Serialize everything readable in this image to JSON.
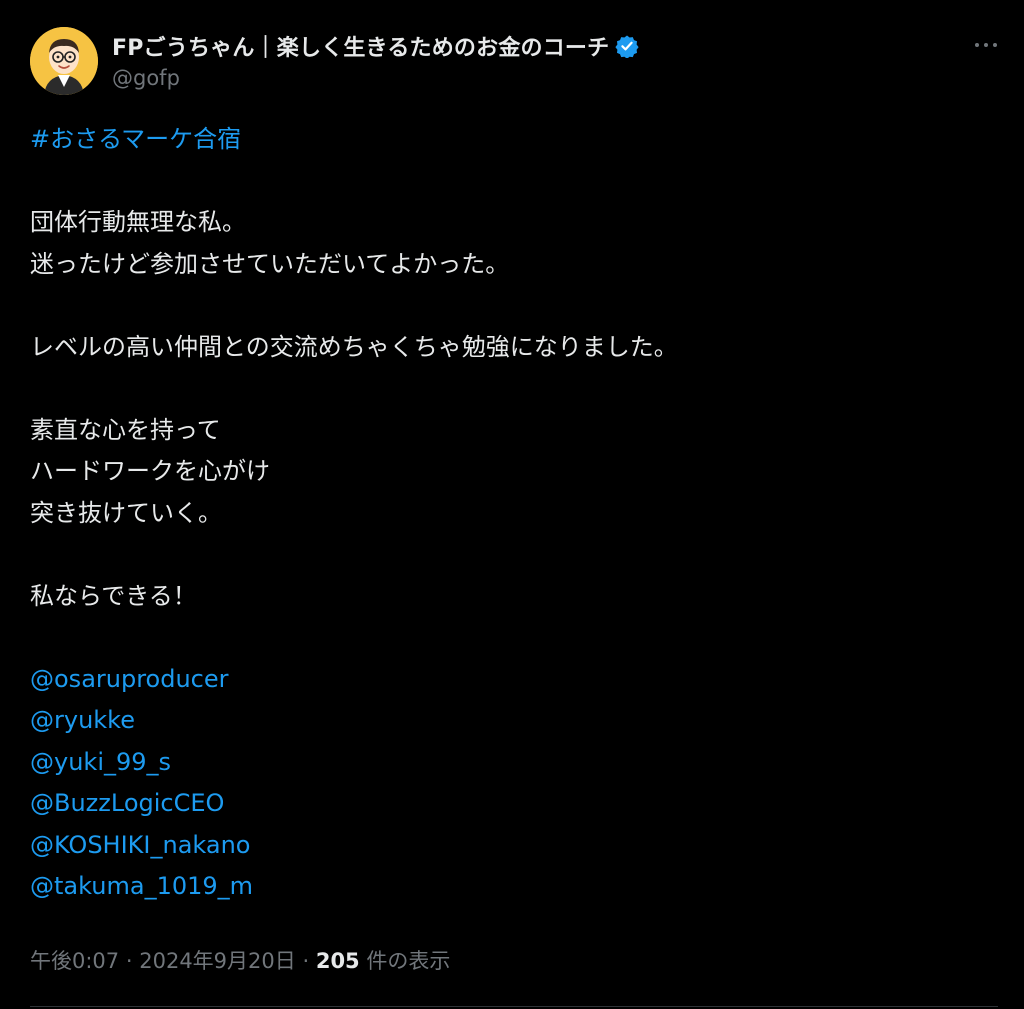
{
  "author": {
    "display_name": "FPごうちゃん｜楽しく生きるためのお金のコーチ",
    "handle": "@gofp",
    "verified_icon": "verified-badge-icon",
    "avatar_icon": "avatar-illustration"
  },
  "more_icon": "more-options-icon",
  "tweet": {
    "hashtag": "#おさるマーケ合宿",
    "para1": [
      "団体行動無理な私。",
      "迷ったけど参加させていただいてよかった。"
    ],
    "para2": [
      "レベルの高い仲間との交流めちゃくちゃ勉強になりました。"
    ],
    "para3": [
      "素直な心を持って",
      "ハードワークを心がけ",
      "突き抜けていく。"
    ],
    "para4": [
      "私ならできる！"
    ],
    "mentions": [
      "@osaruproducer",
      "@ryukke",
      "@yuki_99_s",
      "@BuzzLogicCEO",
      "@KOSHIKI_nakano",
      "@takuma_1019_m"
    ]
  },
  "meta": {
    "time": "午後0:07",
    "date": "2024年9月20日",
    "views": "205",
    "views_label": "件の表示",
    "separator": "·"
  },
  "colors": {
    "background": "#000000",
    "text": "#e7e9ea",
    "secondary": "#71767b",
    "link": "#1d9bf0",
    "verified": "#1d9bf0"
  }
}
